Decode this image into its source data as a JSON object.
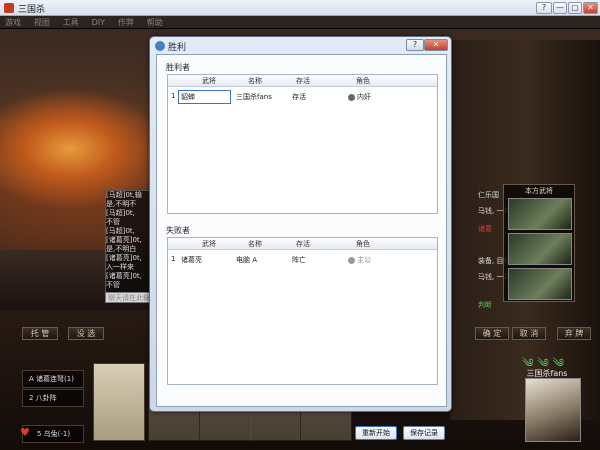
{
  "app": {
    "title": "三国杀",
    "menu": [
      "游戏",
      "视图",
      "工具",
      "DIY",
      "作弊",
      "帮助"
    ],
    "win_buttons": [
      "?",
      "—",
      "▢",
      "✕"
    ]
  },
  "chat": {
    "lines": [
      "[马超]0t,输",
      "是,不明不",
      "[马超]0t,",
      "不管",
      "[马超]0t,",
      "[诸葛亮]0t,",
      "是,不明白",
      "[诸葛亮]0t,",
      "入一样来",
      "[诸葛亮]0t,",
      "不管"
    ],
    "input_placeholder": "聊天请在此输入"
  },
  "actions": {
    "left": [
      "托  管",
      "没  选"
    ],
    "right": [
      "确  定",
      "取  消",
      "弃  牌"
    ]
  },
  "skills": [
    "A 诸葛连弩(1)",
    "2 八卦阵",
    "5 乌兔(-1)"
  ],
  "opponent": {
    "panel_title": "本方武将",
    "lines": [
      {
        "text": "仁乐国",
        "style": "normal"
      },
      {
        "text": "马钱, 一并",
        "style": "normal"
      },
      {
        "text": "诸葛",
        "style": "red"
      },
      {
        "text": "装备, 目标是",
        "style": "normal"
      },
      {
        "text": "马钱, 一并",
        "style": "normal"
      },
      {
        "text": "判断",
        "style": "green"
      }
    ]
  },
  "player": {
    "name": "三国杀fans",
    "hp_icons": "༄ ༄ ༄",
    "heart": "♥"
  },
  "dialog": {
    "title": "胜利",
    "help_label": "?",
    "close_label": "✕",
    "winners": {
      "label": "胜利者",
      "headers": [
        "武将",
        "名称",
        "存活",
        "角色"
      ],
      "rows": [
        {
          "index": "1",
          "general": "貂蝉",
          "name": "三国杀fans",
          "status": "存活",
          "role": "内奸"
        }
      ]
    },
    "losers": {
      "label": "失败者",
      "headers": [
        "武将",
        "名称",
        "存活",
        "角色"
      ],
      "rows": [
        {
          "index": "1",
          "general": "诸葛亮",
          "name": "电脑 A",
          "status": "阵亡",
          "role": "主公"
        }
      ]
    },
    "restart_label": "重新开始",
    "save_label": "保存记录"
  }
}
